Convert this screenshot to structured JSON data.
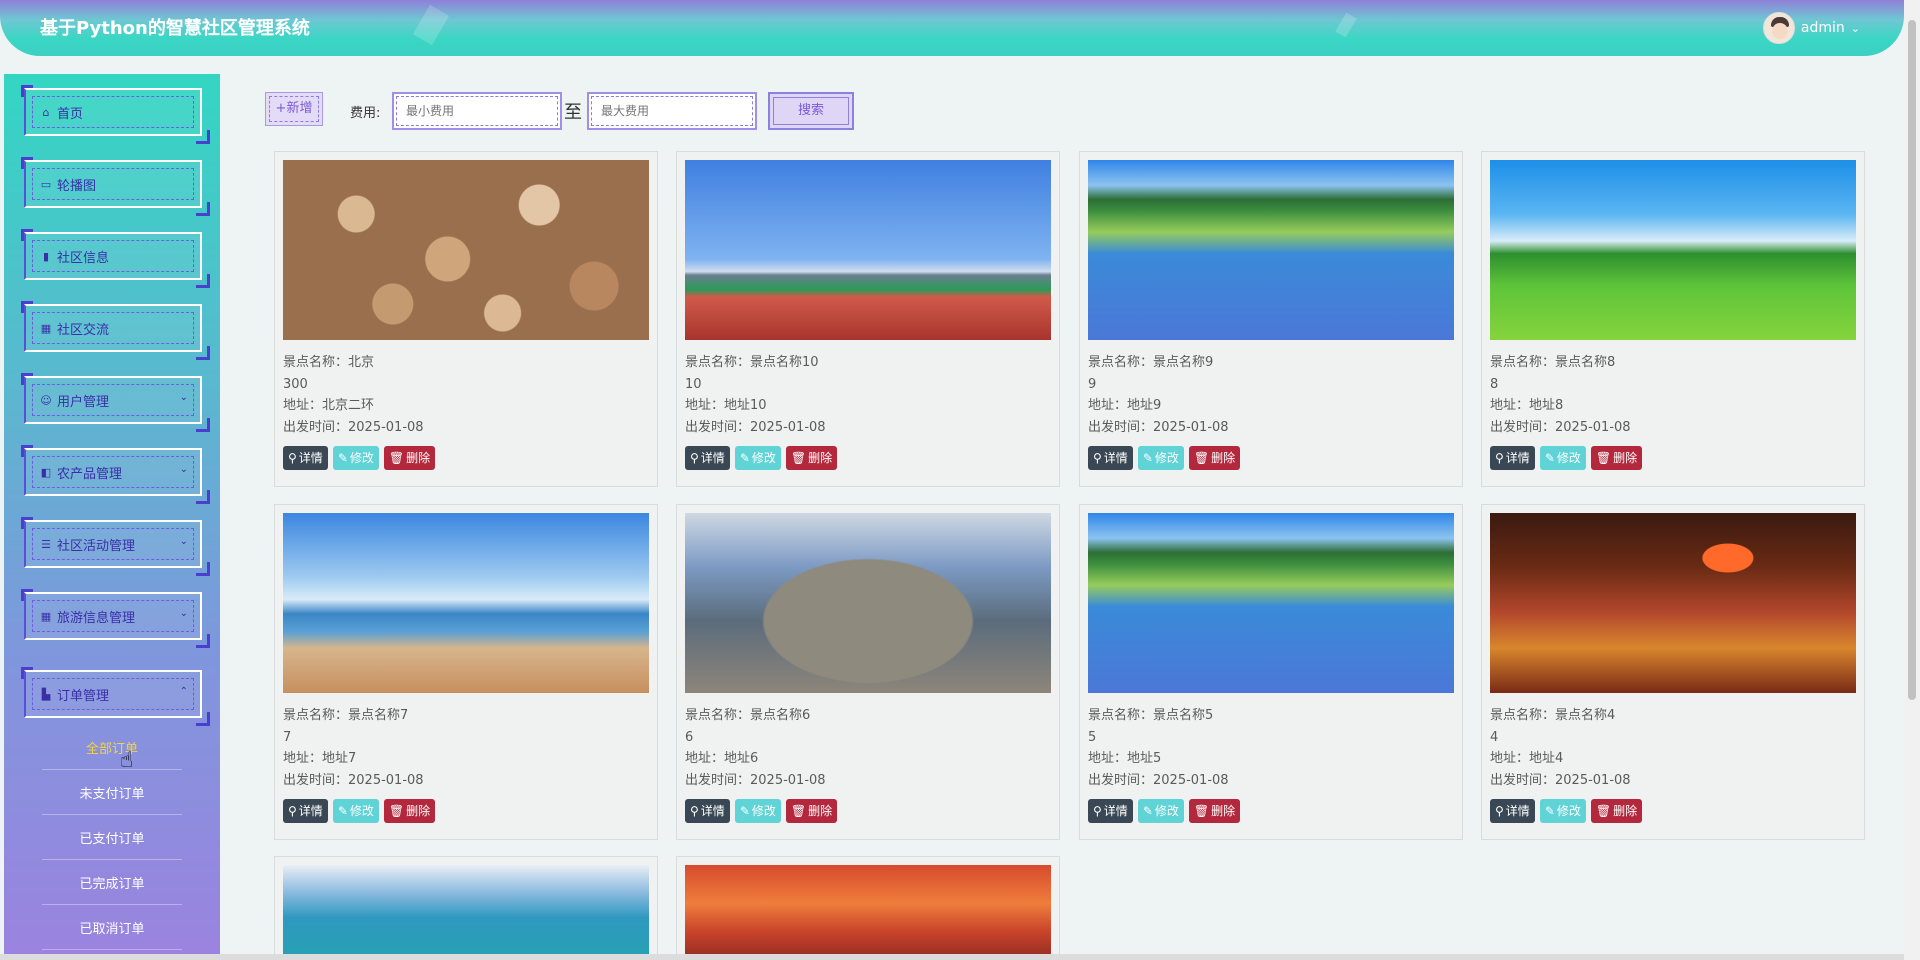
{
  "header": {
    "title": "基于Python的智慧社区管理系统",
    "user": "admin"
  },
  "sidebar": {
    "items": [
      {
        "label": "首页",
        "icon": "home-icon"
      },
      {
        "label": "轮播图",
        "icon": "image-icon"
      },
      {
        "label": "社区信息",
        "icon": "book-icon"
      },
      {
        "label": "社区交流",
        "icon": "grid-icon"
      },
      {
        "label": "用户管理",
        "icon": "user-icon"
      },
      {
        "label": "农产品管理",
        "icon": "box-icon"
      },
      {
        "label": "社区活动管理",
        "icon": "list-icon"
      },
      {
        "label": "旅游信息管理",
        "icon": "apps-icon"
      },
      {
        "label": "订单管理",
        "icon": "bag-icon"
      }
    ],
    "sub_items": [
      "全部订单",
      "未支付订单",
      "已支付订单",
      "已完成订单",
      "已取消订单"
    ],
    "active_sub": "全部订单"
  },
  "toolbar": {
    "add_label": "+新增",
    "fee_label": "费用:",
    "min_placeholder": "最小费用",
    "to_label": "至",
    "max_placeholder": "最大费用",
    "search_label": "搜索"
  },
  "card_labels": {
    "name_prefix": "景点名称：",
    "address_prefix": "地址：",
    "date_prefix": "出发时间：",
    "detail": "详情",
    "edit": "修改",
    "delete": "删除"
  },
  "cards": [
    {
      "name": "北京",
      "fee": "300",
      "address": "北京二环",
      "date": "2025-01-08"
    },
    {
      "name": "景点名称10",
      "fee": "10",
      "address": "地址10",
      "date": "2025-01-08"
    },
    {
      "name": "景点名称9",
      "fee": "9",
      "address": "地址9",
      "date": "2025-01-08"
    },
    {
      "name": "景点名称8",
      "fee": "8",
      "address": "地址8",
      "date": "2025-01-08"
    },
    {
      "name": "景点名称7",
      "fee": "7",
      "address": "地址7",
      "date": "2025-01-08"
    },
    {
      "name": "景点名称6",
      "fee": "6",
      "address": "地址6",
      "date": "2025-01-08"
    },
    {
      "name": "景点名称5",
      "fee": "5",
      "address": "地址5",
      "date": "2025-01-08"
    },
    {
      "name": "景点名称4",
      "fee": "4",
      "address": "地址4",
      "date": "2025-01-08"
    }
  ],
  "colors": {
    "detail_btn": "#3a4855",
    "edit_btn": "#5fd3d6",
    "delete_btn": "#b3283c",
    "active_sub": "#f5d33b"
  }
}
